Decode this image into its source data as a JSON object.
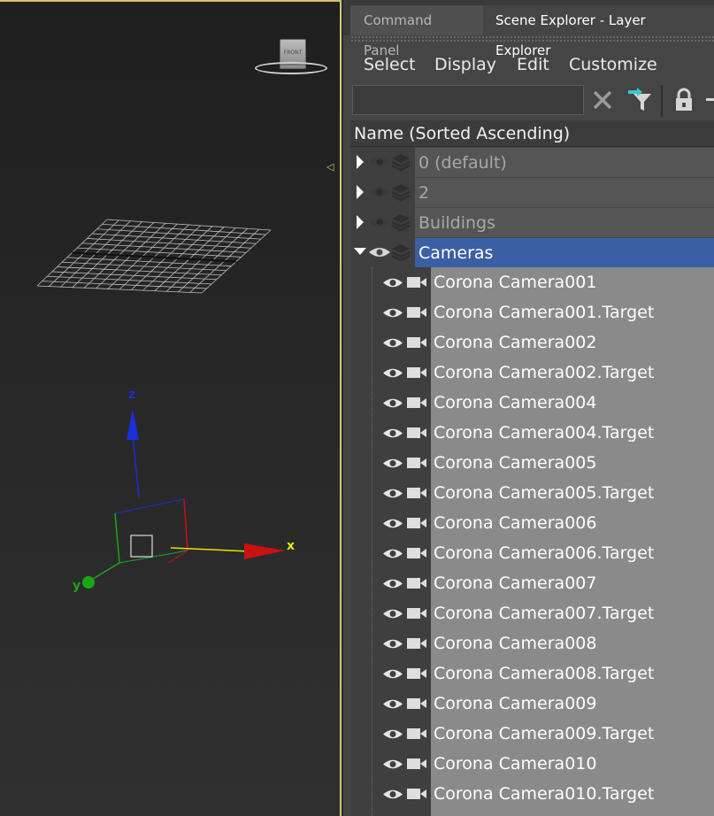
{
  "viewport": {
    "viewcube_face": "FRONT",
    "axis_x": "x",
    "axis_y": "y",
    "axis_z": "z",
    "colors": {
      "border": "#d9c271",
      "x": "#cc1111",
      "y": "#18a818",
      "z": "#1a2fd6",
      "label_x": "#f0e000"
    }
  },
  "panel": {
    "tabs": [
      {
        "label": "Command Panel",
        "active": false
      },
      {
        "label": "Scene Explorer - Layer Explorer",
        "active": true
      }
    ],
    "menu": [
      "Select",
      "Display",
      "Edit",
      "Customize"
    ],
    "search": {
      "value": "",
      "placeholder": ""
    },
    "toolbar_icons": [
      "clear-icon",
      "filter-icon",
      "lock-icon"
    ],
    "column_header": "Name (Sorted Ascending)",
    "layers": [
      {
        "name": "0 (default)",
        "expanded": false,
        "selected": false
      },
      {
        "name": "2",
        "expanded": false,
        "selected": false
      },
      {
        "name": "Buildings",
        "expanded": false,
        "selected": false
      },
      {
        "name": "Cameras",
        "expanded": true,
        "selected": true
      }
    ],
    "cameras": [
      "Corona Camera001",
      "Corona Camera001.Target",
      "Corona Camera002",
      "Corona Camera002.Target",
      "Corona Camera004",
      "Corona Camera004.Target",
      "Corona Camera005",
      "Corona Camera005.Target",
      "Corona Camera006",
      "Corona Camera006.Target",
      "Corona Camera007",
      "Corona Camera007.Target",
      "Corona Camera008",
      "Corona Camera008.Target",
      "Corona Camera009",
      "Corona Camera009.Target",
      "Corona Camera010",
      "Corona Camera010.Target"
    ],
    "colors": {
      "selected_row": "#3a5fa3",
      "camera_row": "#8a8a8a",
      "filter_accent": "#3fc4d0"
    }
  }
}
